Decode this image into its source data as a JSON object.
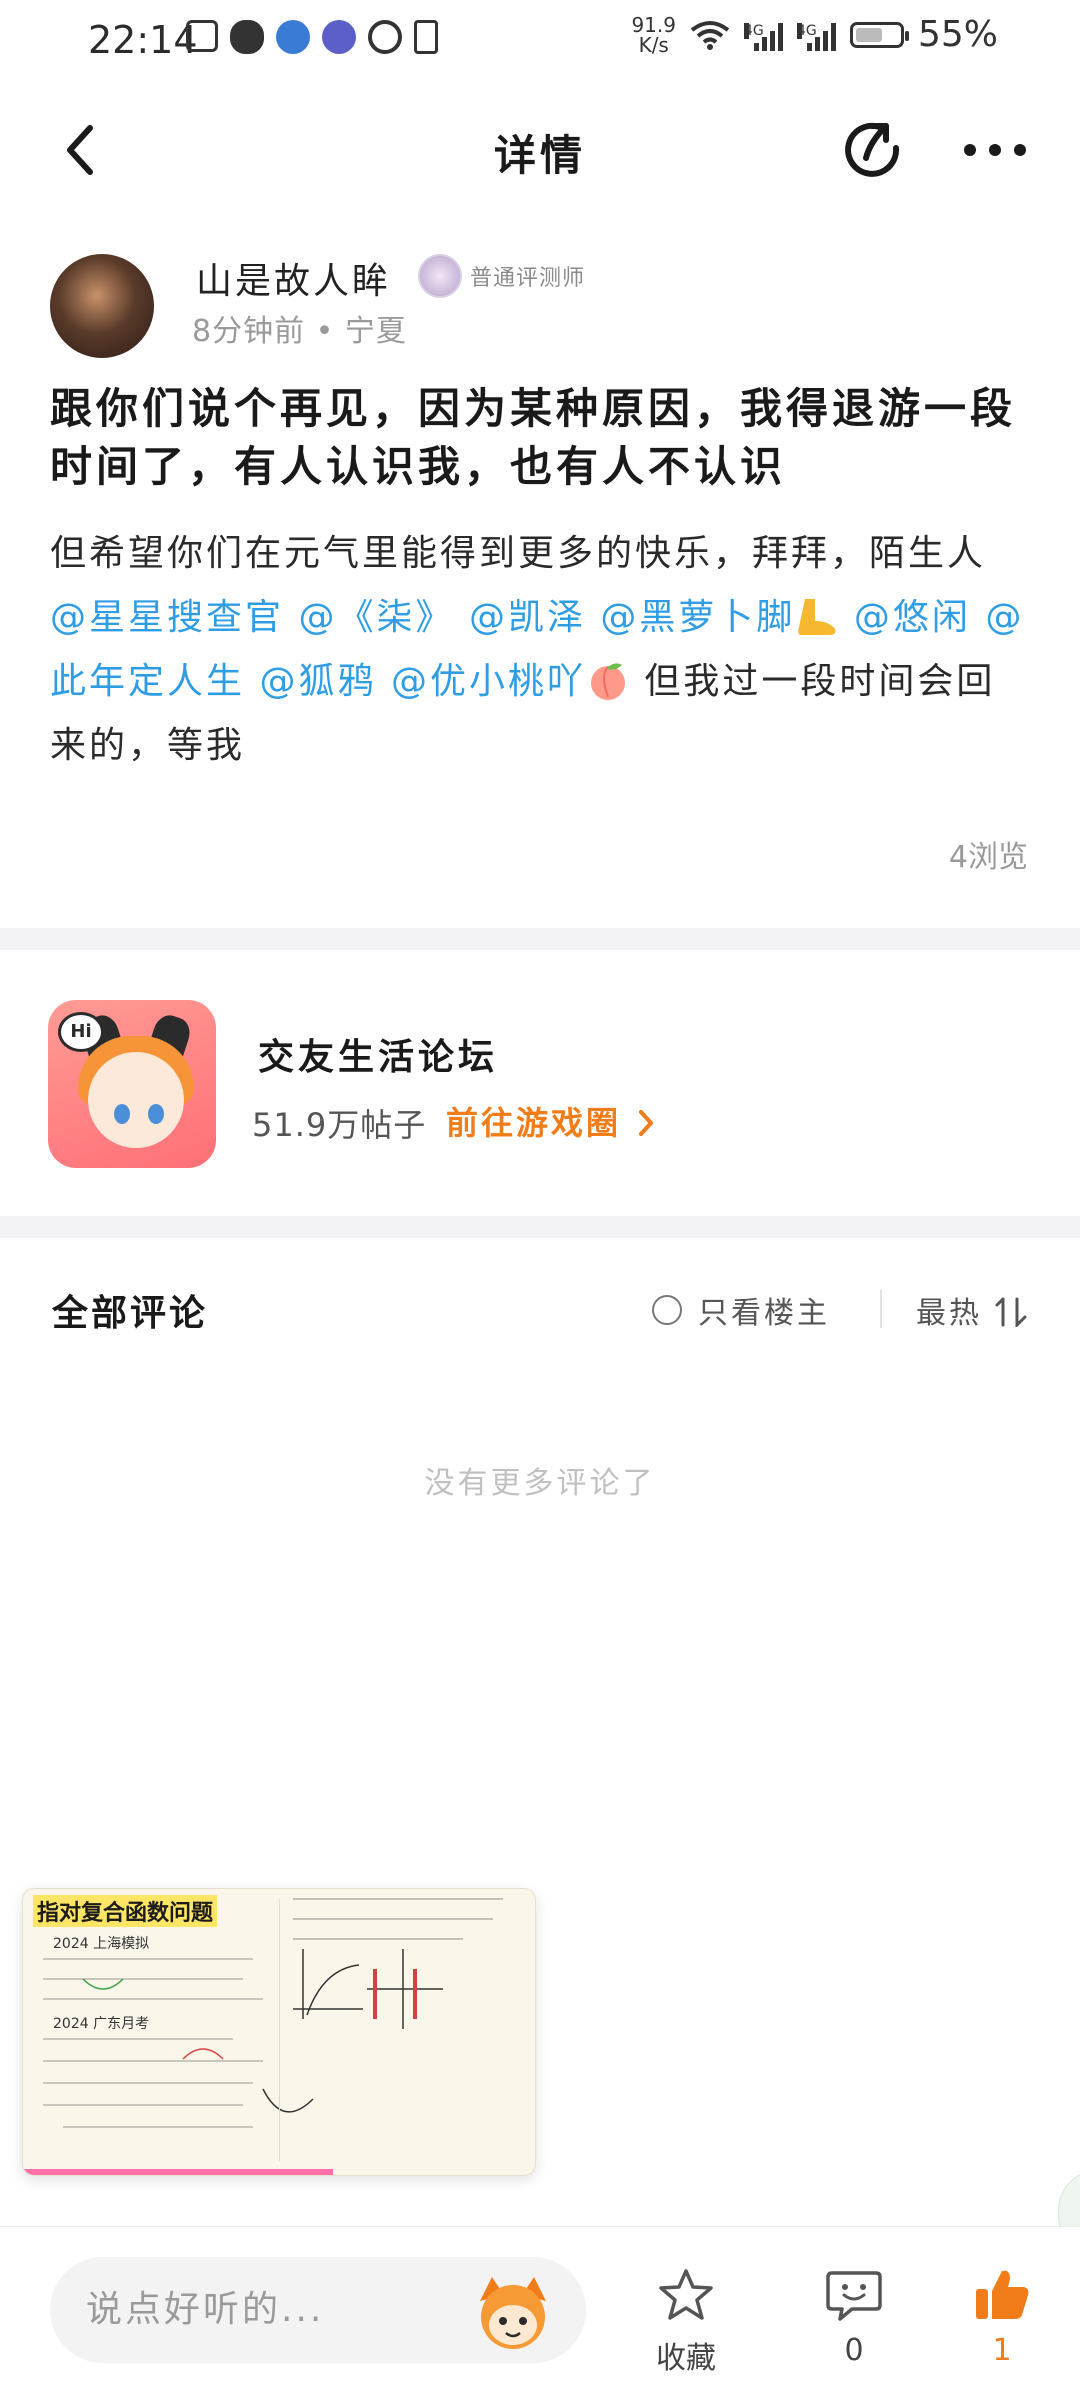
{
  "status_bar": {
    "time": "22:14",
    "net_speed_value": "91.9",
    "net_speed_unit": "K/s",
    "signal_1_tag": "4G",
    "signal_2_tag": "4G",
    "battery": "55%"
  },
  "header": {
    "title": "详情"
  },
  "post": {
    "author_name": "山是故人眸",
    "author_rank": "普通评测师",
    "meta": "8分钟前 • 宁夏",
    "title": "跟你们说个再见，因为某种原因，我得退游一段时间了，有人认识我，也有人不认识",
    "body": {
      "intro": "但希望你们在元气里能得到更多的快乐，拜拜，陌生人",
      "mentions": [
        "@星星搜查官",
        "@《柒》",
        "@凯泽",
        "@黑萝卜脚",
        "@悠闲",
        "@此年定人生",
        "@狐鸦",
        "@优小桃吖"
      ],
      "outro": "但我过一段时间会回来的，等我"
    },
    "views": "4浏览"
  },
  "forum": {
    "name": "交友生活论坛",
    "posts": "51.9万帖子",
    "link_label": "前往游戏圈",
    "icon_text": "Hi"
  },
  "comments": {
    "title": "全部评论",
    "only_op_label": "只看楼主",
    "sort_label": "最热",
    "empty_text": "没有更多评论了"
  },
  "ad": {
    "title": "指对复合函数问题",
    "line_1": "2024 上海模拟",
    "line_2": "2024 广东月考"
  },
  "bottom_bar": {
    "input_placeholder": "说点好听的...",
    "favorite_label": "收藏",
    "comment_count": "0",
    "like_count": "1"
  },
  "colors": {
    "accent_orange": "#f07c1a",
    "mention_blue": "#2f9de4",
    "muted_text": "#9a9a9a",
    "divider": "#f3f3f5"
  }
}
